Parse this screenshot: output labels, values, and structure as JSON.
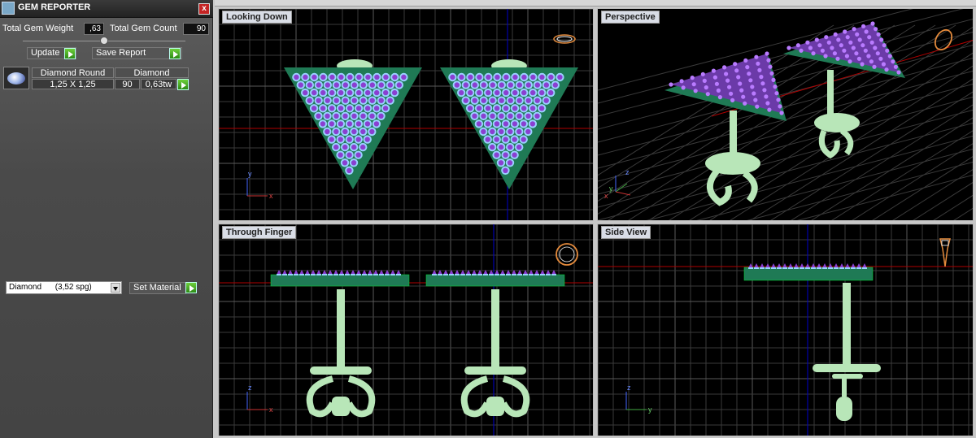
{
  "panel": {
    "title": "GEM REPORTER",
    "close_glyph": "x",
    "total_weight_label": "Total Gem Weight",
    "total_weight_value": ",63",
    "total_count_label": "Total Gem Count",
    "total_count_value": "90",
    "update_label": "Update",
    "save_label": "Save Report",
    "table": {
      "headers": [
        "Diamond Round",
        "Diamond"
      ],
      "row": {
        "size": "1,25 X 1,25",
        "count": "90",
        "weight": "0,63tw"
      }
    },
    "material": {
      "selected": "Diamond      (3,52 spg)",
      "set_label": "Set Material"
    }
  },
  "viewports": [
    {
      "name": "Looking Down",
      "axes": [
        "y",
        "x"
      ],
      "corner_icon": "ring-top-icon"
    },
    {
      "name": "Perspective",
      "axes": [
        "z",
        "y",
        "x"
      ],
      "corner_icon": "ring-perspective-icon"
    },
    {
      "name": "Through Finger",
      "axes": [
        "z",
        "x"
      ],
      "corner_icon": "ring-front-icon"
    },
    {
      "name": "Side View",
      "axes": [
        "z",
        "y"
      ],
      "corner_icon": "ring-side-icon"
    }
  ],
  "colors": {
    "grid": "#3a3a3a",
    "grid_major": "#5a5a5a",
    "model_metal": "#b8e6b8",
    "setting": "#1f7a55",
    "gem_purple": "#8a3fd1",
    "gem_light": "#9ad0ff",
    "axis_red": "#b00000",
    "axis_blue": "#0000cc",
    "label_bg": "#d9dde6"
  }
}
